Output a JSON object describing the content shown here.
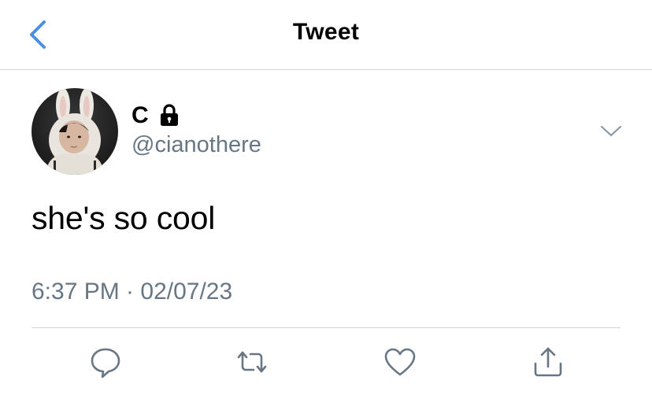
{
  "header": {
    "title": "Tweet",
    "back_icon": "chevron-left-icon",
    "accent_color": "#4a90e2"
  },
  "tweet": {
    "author": {
      "display_name": "C",
      "protected_icon": "lock-icon",
      "handle": "@cianothere"
    },
    "text": "she's so cool",
    "timestamp": "6:37 PM · 02/07/23",
    "menu_icon": "chevron-down-icon"
  },
  "actions": [
    {
      "name": "reply",
      "icon": "reply-icon"
    },
    {
      "name": "retweet",
      "icon": "retweet-icon"
    },
    {
      "name": "like",
      "icon": "heart-icon"
    },
    {
      "name": "share",
      "icon": "share-icon"
    }
  ],
  "colors": {
    "secondary_text": "#687684",
    "divider": "#d3d3d3",
    "icon_gray": "#687684"
  }
}
